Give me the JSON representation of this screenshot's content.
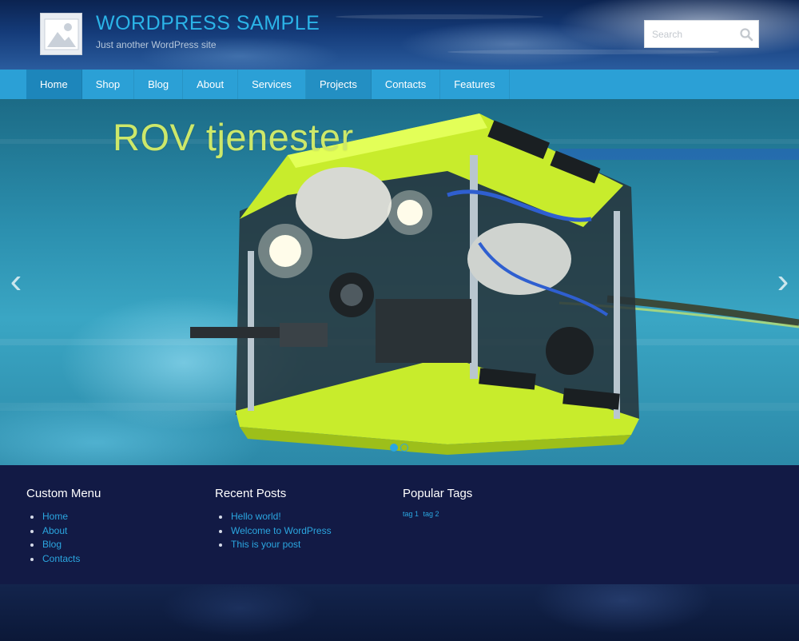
{
  "header": {
    "site_title": "WORDPRESS SAMPLE",
    "site_description": "Just another WordPress site",
    "logo_icon": "image-placeholder-icon",
    "search": {
      "placeholder": "Search",
      "value": "",
      "icon": "search-icon"
    }
  },
  "nav": {
    "items": [
      {
        "label": "Home"
      },
      {
        "label": "Shop"
      },
      {
        "label": "Blog"
      },
      {
        "label": "About"
      },
      {
        "label": "Services"
      },
      {
        "label": "Projects"
      },
      {
        "label": "Contacts"
      },
      {
        "label": "Features"
      }
    ],
    "active": "Home"
  },
  "slider": {
    "caption": "ROV tjenester",
    "prev_icon": "chevron-left-icon",
    "next_icon": "chevron-right-icon",
    "slide_count": 2,
    "current_slide": 1
  },
  "widgets": {
    "custom_menu": {
      "title": "Custom Menu",
      "items": [
        "Home",
        "About",
        "Blog",
        "Contacts"
      ]
    },
    "recent_posts": {
      "title": "Recent Posts",
      "items": [
        "Hello world!",
        "Welcome to WordPress",
        "This is your post"
      ]
    },
    "popular_tags": {
      "title": "Popular Tags",
      "tags": [
        "tag 1",
        "tag 2"
      ]
    }
  },
  "colors": {
    "accent": "#2ba6e0",
    "nav_bg": "#2ba0d6",
    "footer_bg": "#121a45",
    "caption": "#cde86a"
  }
}
